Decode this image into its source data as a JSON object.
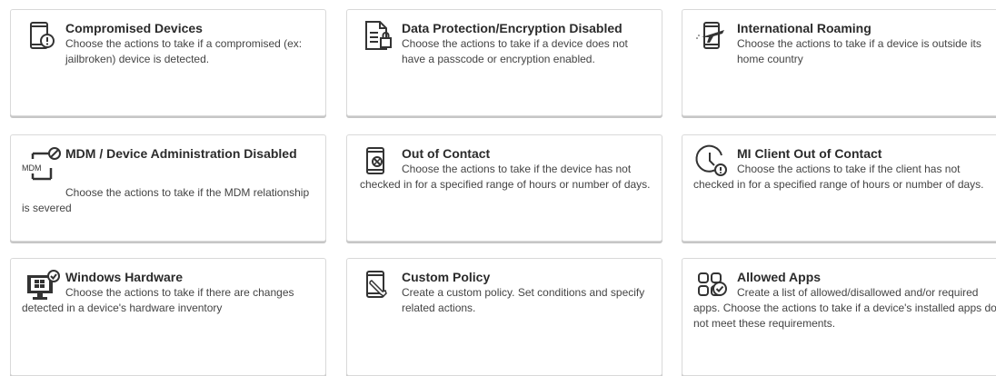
{
  "cards": [
    {
      "title": "Compromised Devices",
      "description": "Choose the actions to take if a compromised (ex: jailbroken) device is detected.",
      "icon": "compromised-device-icon"
    },
    {
      "title": "Data Protection/Encryption Disabled",
      "description": "Choose the actions to take if a device does not have a passcode or encryption enabled.",
      "icon": "document-lock-icon"
    },
    {
      "title": "International Roaming",
      "description": "Choose the actions to take if a device is outside its home country",
      "icon": "phone-plane-icon"
    },
    {
      "title": "MDM / Device Administration Disabled",
      "description": "Choose the actions to take if the MDM relationship is severed",
      "icon": "mdm-disabled-icon",
      "icon_text": "MDM"
    },
    {
      "title": "Out of Contact",
      "description": "Choose the actions to take if the device has not checked in for a specified range of hours or number of days.",
      "icon": "phone-offline-icon"
    },
    {
      "title": "MI Client Out of Contact",
      "description": "Choose the actions to take if the client has not checked in for a specified range of hours or number of days.",
      "icon": "clock-alert-icon"
    },
    {
      "title": "Windows Hardware",
      "description": "Choose the actions to take if there are changes detected in a device's hardware inventory",
      "icon": "windows-monitor-icon"
    },
    {
      "title": "Custom Policy",
      "description": "Create a custom policy. Set conditions and specify related actions.",
      "icon": "phone-wrench-icon"
    },
    {
      "title": "Allowed Apps",
      "description": "Create a list of allowed/disallowed and/or required apps. Choose the actions to take if a device's installed apps do not meet these requirements.",
      "icon": "apps-check-icon"
    }
  ]
}
